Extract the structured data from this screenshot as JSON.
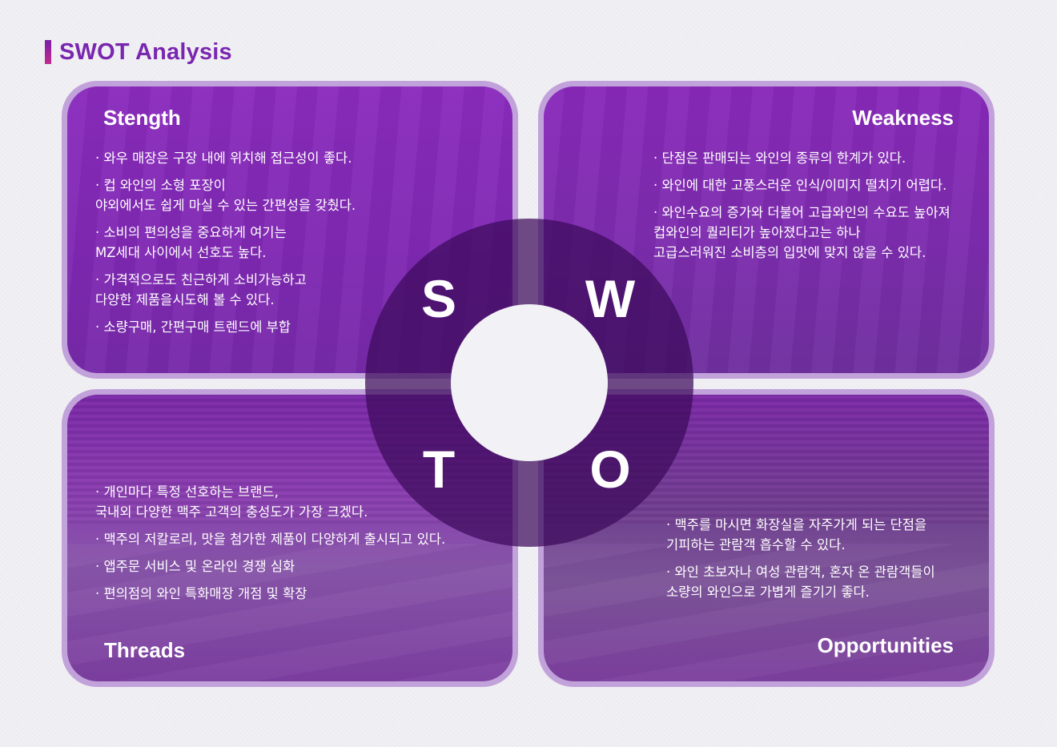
{
  "title": "SWOT Analysis",
  "letters": {
    "s": "S",
    "w": "W",
    "t": "T",
    "o": "O"
  },
  "strength": {
    "heading": "Stength",
    "items": [
      "· 와우 매장은 구장 내에 위치해 접근성이 좋다.",
      "· 컵 와인의 소형 포장이\n  야외에서도 쉽게 마실 수 있는 간편성을 갖췄다.",
      "· 소비의 편의성을 중요하게 여기는\n  MZ세대 사이에서 선호도 높다.",
      "· 가격적으로도 친근하게 소비가능하고\n  다양한 제품을시도해 볼 수 있다.",
      "· 소량구매, 간편구매 트렌드에 부합"
    ]
  },
  "weakness": {
    "heading": "Weakness",
    "items": [
      "· 단점은 판매되는 와인의 종류의 한계가 있다.",
      "· 와인에 대한 고풍스러운 인식/이미지 떨치기 어렵다.",
      "· 와인수요의 증가와 더불어 고급와인의 수요도 높아져\n  컵와인의 퀄리티가 높아졌다고는 하나\n  고급스러워진 소비층의 입맛에 맞지 않을 수 있다."
    ]
  },
  "threats": {
    "heading": "Threads",
    "items": [
      "· 개인마다 특정 선호하는 브랜드,\n  국내외 다양한 맥주 고객의 충성도가 가장 크겠다.",
      "· 맥주의 저칼로리, 맛을 첨가한 제품이 다양하게 출시되고 있다.",
      "· 앱주문 서비스 및 온라인 경쟁 심화",
      "· 편의점의 와인 특화매장 개점 및 확장"
    ]
  },
  "opportunities": {
    "heading": "Opportunities",
    "items": [
      "· 맥주를 마시면 화장실을 자주가게 되는 단점을\n  기피하는 관람객 흡수할 수 있다.",
      "· 와인 초보자나 여성 관람객, 혼자 온 관람객들이\n  소량의 와인으로 가볍게 즐기기 좋다."
    ]
  },
  "colors": {
    "title": "#7a26b0",
    "card_border": "#ba94d6",
    "ring": "#3c0a5a"
  }
}
